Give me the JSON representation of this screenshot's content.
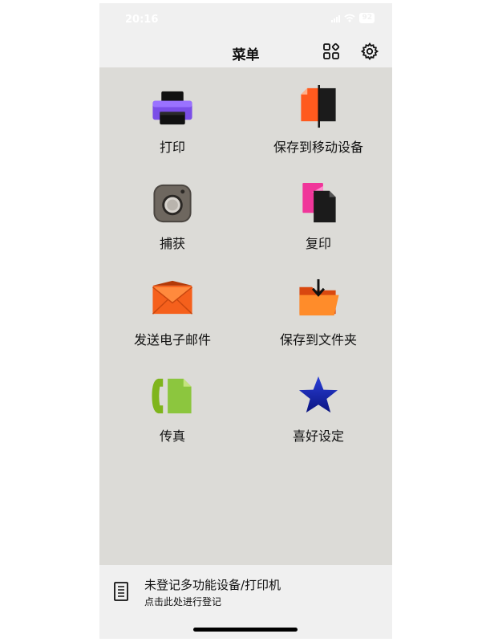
{
  "status": {
    "time": "20:16",
    "battery": "92"
  },
  "header": {
    "title": "菜单"
  },
  "menu": {
    "items": [
      {
        "label": "打印",
        "icon": "printer-icon"
      },
      {
        "label": "保存到移动设备",
        "icon": "save-to-mobile-icon"
      },
      {
        "label": "捕获",
        "icon": "camera-icon"
      },
      {
        "label": "复印",
        "icon": "copy-icon"
      },
      {
        "label": "发送电子邮件",
        "icon": "envelope-icon"
      },
      {
        "label": "保存到文件夹",
        "icon": "folder-download-icon"
      },
      {
        "label": "传真",
        "icon": "fax-icon"
      },
      {
        "label": "喜好设定",
        "icon": "star-icon"
      }
    ]
  },
  "footer": {
    "title": "未登记多功能设备/打印机",
    "subtitle": "点击此处进行登记"
  }
}
